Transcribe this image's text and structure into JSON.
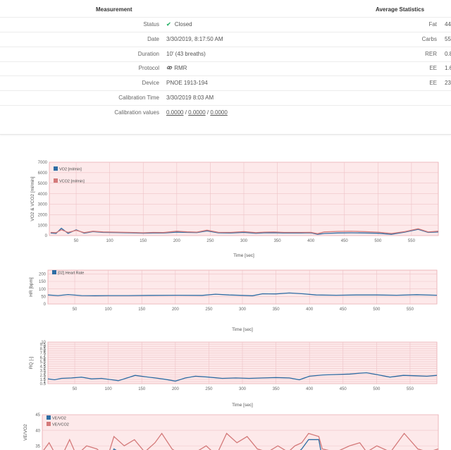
{
  "summary": {
    "measurement_header": "Measurement",
    "stats_header": "Average Statistics",
    "rows": [
      {
        "label": "Status",
        "value": "Closed"
      },
      {
        "label": "Date",
        "value": "3/30/2019, 8:17:50 AM"
      },
      {
        "label": "Duration",
        "value": "10' (43 breaths)"
      },
      {
        "label": "Protocol",
        "value": "RMR"
      },
      {
        "label": "Device",
        "value": "PNOE 1913-194"
      },
      {
        "label": "Calibration Time",
        "value": "3/30/2019 8:03 AM"
      }
    ],
    "calibration": {
      "label": "Calibration values",
      "v1": "0.0000",
      "v2": "0.0000",
      "v3": "0.0000",
      "sep": "/"
    },
    "stats": [
      {
        "label": "Fat",
        "value": "44"
      },
      {
        "label": "Carbs",
        "value": "55"
      },
      {
        "label": "RER",
        "value": "0.8"
      },
      {
        "label": "EE",
        "value": "1.6"
      },
      {
        "label": "EE",
        "value": "23"
      }
    ],
    "icons": {
      "status": "check-icon",
      "protocol": "link-icon"
    },
    "colors": {
      "status_check": "#2fb46c"
    }
  },
  "chart_data": [
    {
      "type": "line",
      "ylabel": "VO2 & VCO2 [ml/min]",
      "xlabel": "Time [sec]",
      "xticks": [
        50,
        100,
        150,
        200,
        250,
        300,
        350,
        400,
        450,
        500,
        550
      ],
      "yticks": [
        0,
        1000,
        2000,
        3000,
        4000,
        5000,
        6000,
        7000
      ],
      "xlim": [
        10,
        590
      ],
      "ylim": [
        0,
        7000
      ],
      "legend_placement": "top-left",
      "grid": true,
      "series": [
        {
          "name": "VO2 [ml/min]",
          "color": "#2e6da4",
          "x": [
            12,
            20,
            28,
            38,
            50,
            62,
            75,
            90,
            110,
            130,
            150,
            165,
            180,
            200,
            215,
            230,
            245,
            262,
            280,
            300,
            318,
            330,
            345,
            360,
            385,
            400,
            410,
            420,
            440,
            460,
            480,
            500,
            520,
            540,
            560,
            575,
            590
          ],
          "y": [
            240,
            200,
            700,
            210,
            550,
            230,
            380,
            300,
            290,
            260,
            230,
            250,
            240,
            330,
            300,
            290,
            450,
            260,
            250,
            300,
            220,
            260,
            270,
            250,
            240,
            260,
            120,
            200,
            250,
            260,
            250,
            220,
            120,
            330,
            600,
            300,
            350
          ]
        },
        {
          "name": "VCO2 [ml/min]",
          "color": "#d47a7a",
          "x": [
            12,
            20,
            28,
            38,
            50,
            62,
            75,
            90,
            110,
            130,
            150,
            165,
            180,
            200,
            215,
            230,
            245,
            262,
            280,
            300,
            318,
            330,
            345,
            360,
            385,
            400,
            410,
            420,
            440,
            460,
            480,
            500,
            520,
            540,
            560,
            575,
            590
          ],
          "y": [
            300,
            280,
            550,
            300,
            500,
            280,
            420,
            350,
            330,
            300,
            270,
            300,
            290,
            420,
            360,
            330,
            520,
            310,
            300,
            380,
            280,
            330,
            340,
            300,
            300,
            310,
            180,
            350,
            400,
            410,
            380,
            330,
            200,
            380,
            650,
            340,
            420
          ]
        }
      ]
    },
    {
      "type": "line",
      "ylabel": "HR [bpm]",
      "xlabel": "Time [sec]",
      "xticks": [
        50,
        100,
        150,
        200,
        250,
        300,
        350,
        400,
        450,
        500,
        550
      ],
      "yticks": [
        0,
        50,
        100,
        150,
        200
      ],
      "xlim": [
        10,
        590
      ],
      "ylim": [
        0,
        225
      ],
      "legend_placement": "top-left",
      "grid": true,
      "series": [
        {
          "name": "[02] Heart Rate",
          "color": "#2e6da4",
          "x": [
            10,
            25,
            40,
            60,
            80,
            100,
            130,
            160,
            200,
            240,
            260,
            280,
            300,
            315,
            330,
            350,
            370,
            390,
            410,
            440,
            470,
            500,
            530,
            560,
            590
          ],
          "y": [
            60,
            56,
            63,
            56,
            55,
            56,
            56,
            57,
            58,
            57,
            65,
            60,
            57,
            55,
            68,
            67,
            73,
            68,
            60,
            58,
            60,
            60,
            58,
            62,
            58
          ]
        }
      ]
    },
    {
      "type": "line",
      "ylabel": "RQ [-]",
      "xlabel": "Time [sec]",
      "xticks": [
        50,
        100,
        150,
        200,
        250,
        300,
        350,
        400,
        450,
        500,
        550
      ],
      "yticks": [
        0.5,
        1,
        1.5,
        2,
        2.5,
        3,
        3.5,
        4,
        4.5,
        5,
        5.5,
        6,
        6.5,
        7,
        7.5,
        8,
        8.5,
        9,
        9.5,
        10
      ],
      "xlim": [
        10,
        590
      ],
      "ylim": [
        0.5,
        10
      ],
      "grid": true,
      "series": [
        {
          "name": "RQ",
          "color": "#2e6da4",
          "x": [
            10,
            20,
            30,
            45,
            60,
            75,
            90,
            105,
            115,
            130,
            140,
            155,
            170,
            185,
            200,
            215,
            230,
            250,
            270,
            290,
            310,
            330,
            350,
            370,
            385,
            400,
            420,
            440,
            460,
            475,
            485,
            500,
            520,
            540,
            560,
            575,
            590
          ],
          "y": [
            1.6,
            1.4,
            1.7,
            1.8,
            2.0,
            1.6,
            1.7,
            1.4,
            1.2,
            1.9,
            2.4,
            2.1,
            1.8,
            1.5,
            1.1,
            1.8,
            2.2,
            2.0,
            1.7,
            1.8,
            1.7,
            1.8,
            1.9,
            1.8,
            1.4,
            2.2,
            2.5,
            2.6,
            2.7,
            2.9,
            3.0,
            2.6,
            2.0,
            2.4,
            2.3,
            2.2,
            2.4
          ]
        }
      ]
    },
    {
      "type": "line",
      "ylabel": "VE/VO2",
      "xlabel": "",
      "yticks": [
        35,
        40,
        45
      ],
      "xlim": [
        10,
        590
      ],
      "ylim": [
        28,
        45
      ],
      "legend_placement": "top-left",
      "grid": true,
      "series": [
        {
          "name": "VE/VO2",
          "color": "#2e6da4",
          "x": [
            10,
            20,
            35,
            50,
            60,
            75,
            90,
            105,
            115,
            130,
            145,
            160,
            175,
            185,
            200,
            220,
            235,
            250,
            265,
            280,
            295,
            310,
            325,
            340,
            355,
            370,
            380,
            390,
            400,
            415,
            420,
            440,
            460,
            475,
            485,
            500,
            520,
            540,
            560,
            575,
            590
          ],
          "y": [
            31,
            28,
            29,
            33,
            30,
            31,
            32,
            29,
            34,
            32,
            29,
            30,
            31,
            33,
            30,
            28,
            30,
            31,
            29,
            33,
            31,
            32,
            30,
            29,
            31,
            30,
            32,
            34,
            37,
            37,
            31,
            30,
            33,
            31,
            29,
            32,
            30,
            33,
            31,
            29,
            30
          ]
        },
        {
          "name": "VE/VCO2",
          "color": "#d47a7a",
          "x": [
            10,
            20,
            35,
            50,
            60,
            75,
            90,
            105,
            115,
            130,
            145,
            160,
            175,
            185,
            200,
            220,
            235,
            250,
            265,
            280,
            295,
            310,
            325,
            340,
            355,
            370,
            380,
            390,
            400,
            415,
            420,
            440,
            460,
            475,
            485,
            500,
            520,
            540,
            560,
            575,
            590
          ],
          "y": [
            33,
            36,
            30,
            37,
            32,
            35,
            34,
            31,
            38,
            35,
            37,
            33,
            36,
            39,
            34,
            31,
            33,
            35,
            32,
            39,
            36,
            38,
            34,
            33,
            35,
            33,
            35,
            36,
            39,
            38,
            34,
            33,
            35,
            36,
            33,
            35,
            33,
            39,
            34,
            33,
            34
          ]
        }
      ]
    }
  ]
}
